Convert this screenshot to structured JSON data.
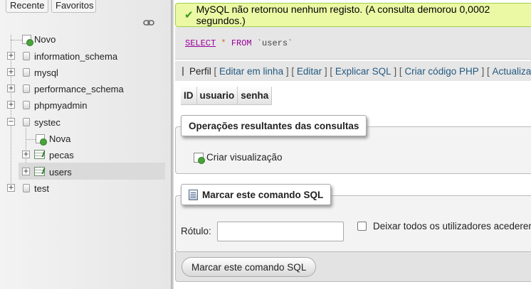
{
  "nav": {
    "tabs": {
      "recent": "Recente",
      "favorites": "Favoritos"
    },
    "tree": {
      "new": "Novo",
      "databases": [
        "information_schema",
        "mysql",
        "performance_schema",
        "phpmyadmin",
        "systec",
        "test"
      ],
      "systec_children": {
        "new": "Nova",
        "tables": [
          "pecas",
          "users"
        ]
      },
      "expander_collapsed": "+",
      "expander_expanded": "−"
    }
  },
  "main": {
    "success_message": "MySQL não retornou nenhum registo. (A consulta demorou 0,0002 segundos.)",
    "sql": {
      "keyword": "SELECT",
      "star": "*",
      "from": "FROM",
      "table": "`users`"
    },
    "toolbar": {
      "profile_label": "Perfil",
      "links": [
        "Editar em linha",
        "Editar",
        "Explicar SQL",
        "Criar código PHP",
        "Actualizar"
      ]
    },
    "columns": [
      "ID",
      "usuario",
      "senha"
    ],
    "operations": {
      "legend": "Operações resultantes das consultas",
      "create_view": "Criar visualização"
    },
    "bookmark": {
      "legend": "Marcar este comando SQL",
      "label_text": "Rótulo:",
      "label_value": "",
      "share_text": "Deixar todos os utilizadores acederem",
      "submit": "Marcar este comando SQL"
    }
  },
  "colors": {
    "success_bg": "#ebf8a4",
    "link": "#235a81",
    "sql_keyword": "#990099"
  }
}
